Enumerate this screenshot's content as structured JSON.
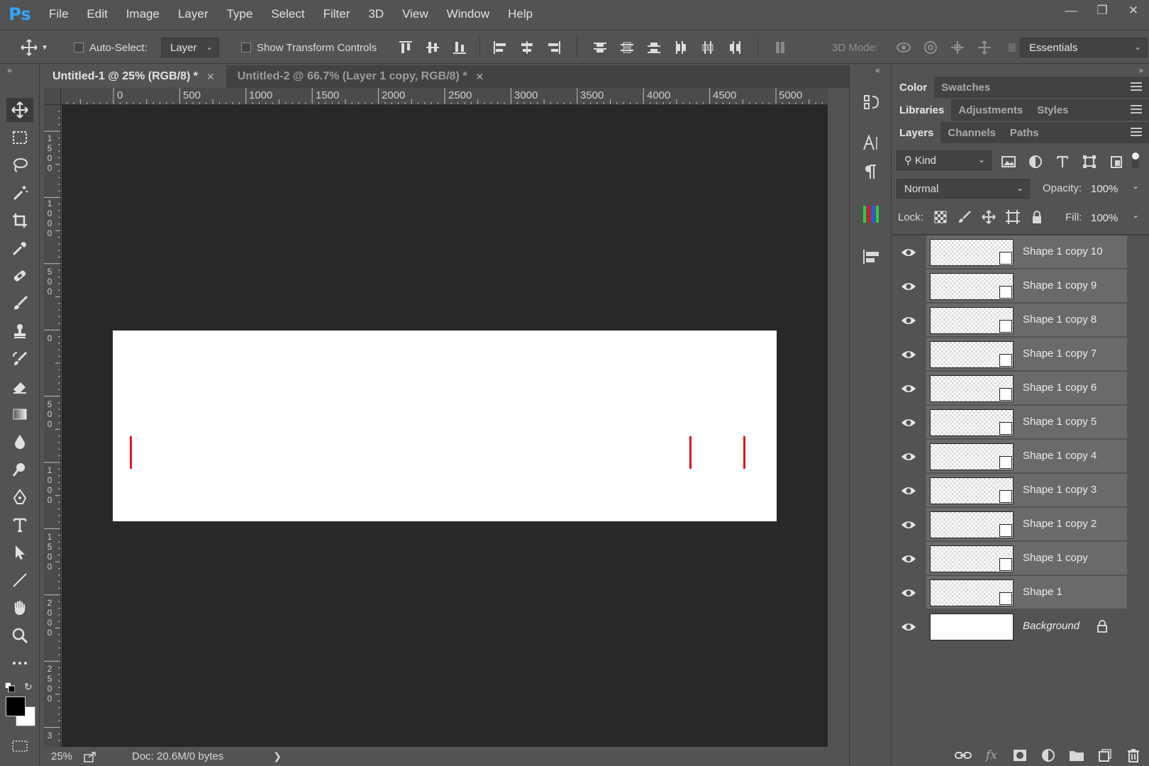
{
  "app": {
    "logo": "Ps"
  },
  "menu": [
    "File",
    "Edit",
    "Image",
    "Layer",
    "Type",
    "Select",
    "Filter",
    "3D",
    "View",
    "Window",
    "Help"
  ],
  "options": {
    "auto_select_label": "Auto-Select:",
    "auto_select_value": "Layer",
    "show_transform_label": "Show Transform Controls",
    "mode3d_label": "3D Mode:",
    "workspace": "Essentials"
  },
  "tabs": [
    {
      "label": "Untitled-1 @ 25% (RGB/8) *",
      "active": true
    },
    {
      "label": "Untitled-2 @ 66.7% (Layer 1 copy, RGB/8) *",
      "active": false
    }
  ],
  "ruler_top": [
    "0",
    "500",
    "1000",
    "1500",
    "2000",
    "2500",
    "3000",
    "3500",
    "4000",
    "4500",
    "5000"
  ],
  "ruler_left": [
    "1500",
    "1000",
    "500",
    "0",
    "500",
    "1000",
    "1500",
    "2000",
    "2500",
    "3"
  ],
  "status": {
    "zoom": "25%",
    "doc": "Doc: 20.6M/0 bytes"
  },
  "panels": {
    "group1": [
      "Color",
      "Swatches"
    ],
    "group2": [
      "Libraries",
      "Adjustments",
      "Styles"
    ],
    "group3": [
      "Layers",
      "Channels",
      "Paths"
    ]
  },
  "layers_panel": {
    "filter": "Kind",
    "blend_mode": "Normal",
    "opacity_label": "Opacity:",
    "opacity": "100%",
    "lock_label": "Lock:",
    "fill_label": "Fill:",
    "fill": "100%",
    "layers": [
      {
        "name": "Shape 1 copy 10"
      },
      {
        "name": "Shape 1 copy 9"
      },
      {
        "name": "Shape 1 copy 8"
      },
      {
        "name": "Shape 1 copy 7"
      },
      {
        "name": "Shape 1 copy 6"
      },
      {
        "name": "Shape 1 copy 5"
      },
      {
        "name": "Shape 1 copy 4"
      },
      {
        "name": "Shape 1 copy 3"
      },
      {
        "name": "Shape 1 copy 2"
      },
      {
        "name": "Shape 1 copy"
      },
      {
        "name": "Shape 1"
      },
      {
        "name": "Background"
      }
    ]
  },
  "colors": {
    "accent": "#31a8ff",
    "mark": "#e3141b"
  }
}
